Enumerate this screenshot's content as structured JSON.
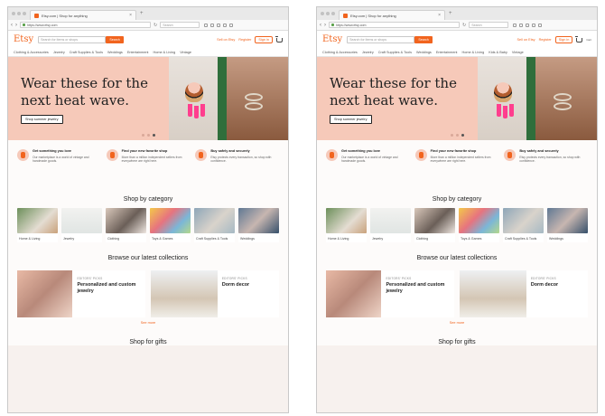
{
  "browser": {
    "tab_title": "Etsy.com | Shop for anything",
    "url": "https://www.etsy.com",
    "search_placeholder": "Search"
  },
  "site": {
    "logo": "Etsy",
    "search_placeholder": "Search for items or shops",
    "search_button": "Search",
    "sell_link": "Sell on Etsy",
    "register_link": "Register",
    "signin_button": "Sign in",
    "cart_label": "Cart",
    "categories": [
      "Clothing & Accessories",
      "Jewelry",
      "Craft Supplies & Tools",
      "Weddings",
      "Entertainment",
      "Home & Living",
      "Kids & Baby",
      "Vintage"
    ]
  },
  "hero": {
    "title": "Wear these for the next heat wave.",
    "cta": "Shop summer jewelry"
  },
  "value_props": [
    {
      "title": "Get something you love",
      "text": "Our marketplace is a world of vintage and handmade goods."
    },
    {
      "title": "Find your new favorite shop",
      "text": "More than a million independent sellers from everywhere are right here."
    },
    {
      "title": "Buy safely and securely",
      "text": "Etsy protects every transaction, so shop with confidence."
    }
  ],
  "sections": {
    "shop_by_category": "Shop by category",
    "browse_collections": "Browse our latest collections",
    "see_more": "See more",
    "shop_for_gifts": "Shop for gifts"
  },
  "category_tiles": [
    "Home & Living",
    "Jewelry",
    "Clothing",
    "Toys & Games",
    "Craft Supplies & Tools",
    "Weddings"
  ],
  "collections": [
    {
      "kicker": "EDITORS' PICKS",
      "title": "Personalized and custom jewelry"
    },
    {
      "kicker": "EDITORS' PICKS",
      "title": "Dorm decor"
    }
  ],
  "colors": {
    "accent": "#f1641e",
    "hero_bg": "#f6c9b9"
  }
}
